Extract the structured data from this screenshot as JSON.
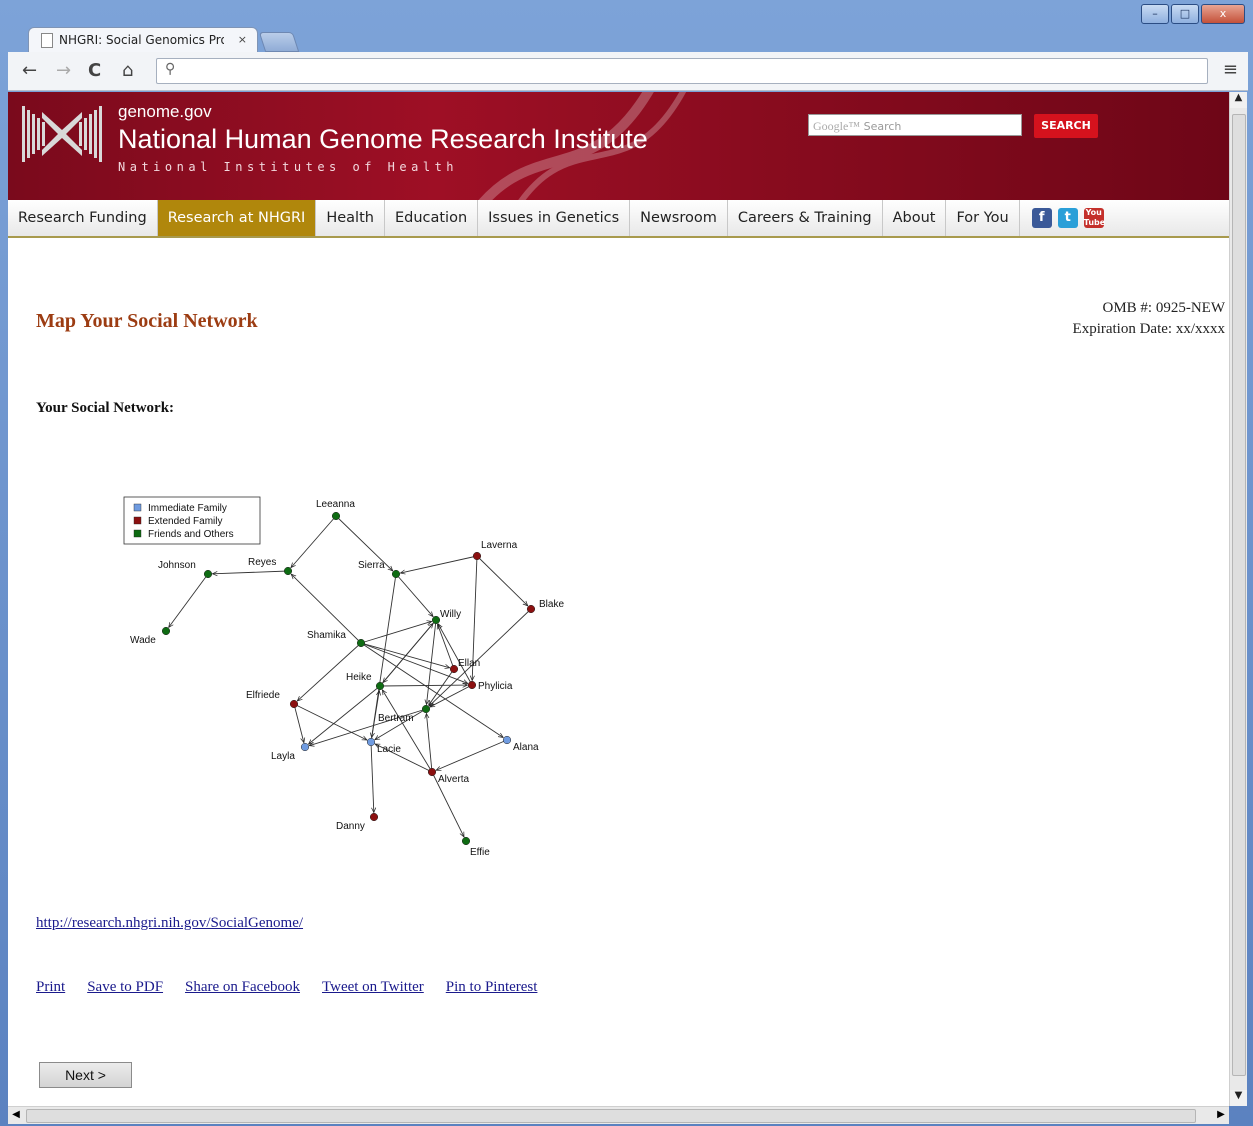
{
  "browser": {
    "tab_title": "NHGRI: Social Genomics Proj",
    "tab_close": "×",
    "address": ""
  },
  "window_controls": {
    "minimize": "–",
    "maximize": "□",
    "close": "x"
  },
  "header": {
    "site_small": "genome.gov",
    "site_name": "National Human Genome Research Institute",
    "parent_org": "National Institutes of Health",
    "search_placeholder": "Search",
    "search_google": "Google™",
    "search_button": "SEARCH"
  },
  "nav": {
    "items": [
      "Research Funding",
      "Research at NHGRI",
      "Health",
      "Education",
      "Issues in Genetics",
      "Newsroom",
      "Careers & Training",
      "About",
      "For You"
    ],
    "active_index": 1,
    "social": [
      "facebook",
      "twitter",
      "youtube"
    ]
  },
  "content": {
    "omb": "OMB #: 0925-NEW",
    "expiration": "Expiration Date: xx/xxxx",
    "title": "Map Your Social Network",
    "section_label": "Your Social Network:",
    "url": "http://research.nhgri.nih.gov/SocialGenome/",
    "actions": [
      "Print",
      "Save to PDF",
      "Share on Facebook",
      "Tweet on Twitter",
      "Pin to Pinterest"
    ],
    "next_button": "Next >"
  },
  "network": {
    "legend": [
      {
        "label": "Immediate Family",
        "color": "#6f9be0"
      },
      {
        "label": "Extended Family",
        "color": "#8b1010"
      },
      {
        "label": "Friends and Others",
        "color": "#0e6b12"
      }
    ],
    "nodes": [
      {
        "name": "Leeanna",
        "group": 2
      },
      {
        "name": "Johnson",
        "group": 2
      },
      {
        "name": "Reyes",
        "group": 2
      },
      {
        "name": "Sierra",
        "group": 2
      },
      {
        "name": "Laverna",
        "group": 1
      },
      {
        "name": "Blake",
        "group": 1
      },
      {
        "name": "Willy",
        "group": 2
      },
      {
        "name": "Wade",
        "group": 2
      },
      {
        "name": "Shamika",
        "group": 2
      },
      {
        "name": "Ellan",
        "group": 1
      },
      {
        "name": "Heike",
        "group": 2
      },
      {
        "name": "Phylicia",
        "group": 1
      },
      {
        "name": "Elfriede",
        "group": 1
      },
      {
        "name": "Bertram",
        "group": 2
      },
      {
        "name": "Lacie",
        "group": 0
      },
      {
        "name": "Layla",
        "group": 0
      },
      {
        "name": "Alana",
        "group": 0
      },
      {
        "name": "Alverta",
        "group": 1
      },
      {
        "name": "Danny",
        "group": 1
      },
      {
        "name": "Effie",
        "group": 2
      }
    ],
    "edges": [
      [
        "Leeanna",
        "Reyes"
      ],
      [
        "Leeanna",
        "Sierra"
      ],
      [
        "Reyes",
        "Johnson"
      ],
      [
        "Johnson",
        "Wade"
      ],
      [
        "Shamika",
        "Reyes"
      ],
      [
        "Sierra",
        "Willy"
      ],
      [
        "Laverna",
        "Sierra"
      ],
      [
        "Laverna",
        "Blake"
      ],
      [
        "Sierra",
        "Lacie"
      ],
      [
        "Shamika",
        "Willy"
      ],
      [
        "Shamika",
        "Ellan"
      ],
      [
        "Shamika",
        "Phylicia"
      ],
      [
        "Shamika",
        "Alana"
      ],
      [
        "Shamika",
        "Elfriede"
      ],
      [
        "Willy",
        "Heike"
      ],
      [
        "Willy",
        "Bertram"
      ],
      [
        "Ellan",
        "Willy"
      ],
      [
        "Ellan",
        "Bertram"
      ],
      [
        "Phylicia",
        "Willy"
      ],
      [
        "Phylicia",
        "Bertram"
      ],
      [
        "Laverna",
        "Phylicia"
      ],
      [
        "Blake",
        "Bertram"
      ],
      [
        "Heike",
        "Willy"
      ],
      [
        "Heike",
        "Phylicia"
      ],
      [
        "Heike",
        "Layla"
      ],
      [
        "Elfriede",
        "Layla"
      ],
      [
        "Elfriede",
        "Lacie"
      ],
      [
        "Bertram",
        "Lacie"
      ],
      [
        "Lacie",
        "Heike"
      ],
      [
        "Lacie",
        "Danny"
      ],
      [
        "Alverta",
        "Lacie"
      ],
      [
        "Alverta",
        "Bertram"
      ],
      [
        "Alverta",
        "Heike"
      ],
      [
        "Alverta",
        "Effie"
      ],
      [
        "Alana",
        "Alverta"
      ],
      [
        "Bertram",
        "Layla"
      ]
    ]
  }
}
